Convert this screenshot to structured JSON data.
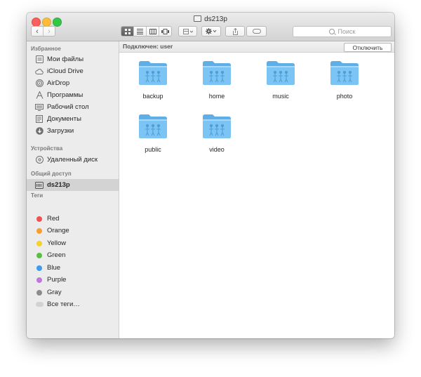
{
  "window": {
    "title": "ds213p"
  },
  "toolbar": {
    "back_glyph": "‹",
    "forward_glyph": "›",
    "view_icons": [
      "grid-view-icon",
      "list-view-icon",
      "column-view-icon",
      "coverflow-view-icon"
    ],
    "arrange_icon": "arrange-icon",
    "action_icon": "gear-icon",
    "share_icon": "share-icon",
    "tag_icon": "tag-icon",
    "search_placeholder": "Поиск"
  },
  "sidebar": {
    "favorites": {
      "title": "Избранное",
      "items": [
        {
          "label": "Мои файлы",
          "icon": "all-files-icon"
        },
        {
          "label": "iCloud Drive",
          "icon": "cloud-icon"
        },
        {
          "label": "AirDrop",
          "icon": "airdrop-icon"
        },
        {
          "label": "Программы",
          "icon": "applications-icon"
        },
        {
          "label": "Рабочий стол",
          "icon": "desktop-icon"
        },
        {
          "label": "Документы",
          "icon": "documents-icon"
        },
        {
          "label": "Загрузки",
          "icon": "downloads-icon"
        }
      ]
    },
    "devices": {
      "title": "Устройства",
      "items": [
        {
          "label": "Удаленный диск",
          "icon": "remote-disc-icon"
        }
      ]
    },
    "shared": {
      "title": "Общий доступ",
      "items": [
        {
          "label": "ds213p",
          "icon": "server-icon",
          "selected": true
        }
      ]
    },
    "tags": {
      "title": "Теги",
      "items": [
        {
          "label": "Red",
          "color": "#f0524f"
        },
        {
          "label": "Orange",
          "color": "#f59f2c"
        },
        {
          "label": "Yellow",
          "color": "#f5d12e"
        },
        {
          "label": "Green",
          "color": "#59c045"
        },
        {
          "label": "Blue",
          "color": "#3d9ced"
        },
        {
          "label": "Purple",
          "color": "#be79d9"
        },
        {
          "label": "Gray",
          "color": "#8c8c8c"
        }
      ],
      "all_tags_label": "Все теги…"
    }
  },
  "pathbar": {
    "connection_text": "Подключен: user",
    "disconnect_label": "Отключить"
  },
  "folders": [
    "backup",
    "home",
    "music",
    "photo",
    "public",
    "video"
  ],
  "colors": {
    "folder_body": "#7cc4f4",
    "folder_tab": "#5eaee8",
    "sidebar_bg": "#ececec",
    "selection_bg": "#d3d3d3"
  }
}
